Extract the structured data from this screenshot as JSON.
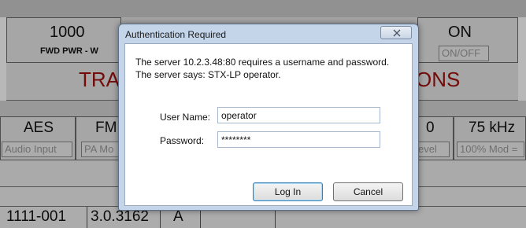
{
  "background": {
    "row1": {
      "fwd_value": "1000",
      "fwd_label": "FWD PWR - W",
      "on_value": "ON",
      "onoff_label": "ON/OFF"
    },
    "row2": {
      "left_text": "TRA",
      "right_text": "ONS"
    },
    "row3": {
      "aes_value": "AES",
      "aes_button": "Audio Input",
      "fm_value": "FM",
      "pa_button": "PA Mo",
      "zero_value": "0",
      "level_button": "evel",
      "khz_value": "75 kHz",
      "mod_button": "100% Mod ="
    },
    "row4": {
      "serial": "1111-001",
      "version": "3.0.3162",
      "letter": "A"
    }
  },
  "dialog": {
    "title": "Authentication Required",
    "message_line1": "The server 10.2.3.48:80 requires a username and password.",
    "message_line2": "The server says: STX-LP operator.",
    "username_label": "User Name:",
    "username_value": "operator",
    "password_label": "Password:",
    "password_value": "********",
    "login_label": "Log In",
    "cancel_label": "Cancel"
  },
  "colors": {
    "alarm_red": "#a01010",
    "dialog_frame": "#c4d5ea"
  }
}
